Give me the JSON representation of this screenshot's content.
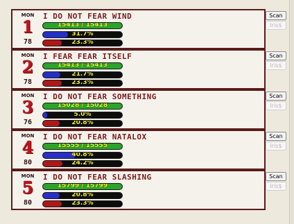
{
  "scan_label": "Scan",
  "iris_label": "Iris$",
  "colors": {
    "card_border": "#5a1b1b",
    "name_text": "#7a1c1c",
    "level_digit": "#c0141c",
    "hp_fill": "#2aa52a",
    "mp_fill": "#2530c8",
    "xp_fill": "#b01818",
    "bar_text": "#f2ef2a"
  },
  "roster": [
    {
      "day": "MON",
      "level": "1",
      "stat": "78",
      "name": "I DO NOT FEAR WIND",
      "hp_text": "15413 / 15413",
      "hp_fraction": 1.0,
      "mp_text": "31.7%",
      "mp_fraction": 0.317,
      "xp_text": "23.3%",
      "xp_fraction": 0.233
    },
    {
      "day": "MON",
      "level": "2",
      "stat": "78",
      "name": "I FEAR FEAR ITSELF",
      "hp_text": "15413 / 15413",
      "hp_fraction": 1.0,
      "mp_text": "21.7%",
      "mp_fraction": 0.217,
      "xp_text": "23.3%",
      "xp_fraction": 0.233
    },
    {
      "day": "MON",
      "level": "3",
      "stat": "76",
      "name": "I DO NOT FEAR SOMETHING",
      "hp_text": "15028 / 15028",
      "hp_fraction": 1.0,
      "mp_text": "5.0%",
      "mp_fraction": 0.05,
      "xp_text": "20.8%",
      "xp_fraction": 0.208
    },
    {
      "day": "MON",
      "level": "4",
      "stat": "80",
      "name": "I DO NOT FEAR NATALOX",
      "hp_text": "15555 / 15555",
      "hp_fraction": 1.0,
      "mp_text": "40.8%",
      "mp_fraction": 0.408,
      "xp_text": "24.2%",
      "xp_fraction": 0.242
    },
    {
      "day": "MON",
      "level": "5",
      "stat": "80",
      "name": "I DO NOT FEAR SLASHING",
      "hp_text": "15799 / 15799",
      "hp_fraction": 1.0,
      "mp_text": "20.8%",
      "mp_fraction": 0.208,
      "xp_text": "23.3%",
      "xp_fraction": 0.233
    }
  ]
}
